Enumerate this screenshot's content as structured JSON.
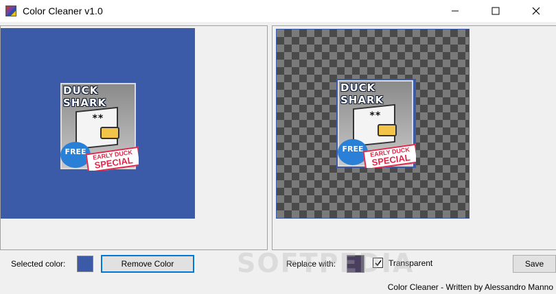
{
  "window": {
    "title": "Color Cleaner v1.0"
  },
  "artwork": {
    "title_line1": "DUCK",
    "title_line2": "SHARK",
    "badge": "FREE",
    "banner_line1": "EARLY DUCK",
    "banner_line2": "SPECIAL",
    "eyes": "**"
  },
  "left_panel": {
    "selected_color_label": "Selected color:",
    "selected_color": "#3b5ba8",
    "remove_color_label": "Remove Color"
  },
  "right_panel": {
    "replace_with_label": "Replace with:",
    "replace_color": "#4a3f5e",
    "transparent_label": "Transparent",
    "transparent_checked": true,
    "save_label": "Save"
  },
  "watermark": "SOFTPEDIA",
  "status": {
    "text": "Color Cleaner - Written by Alessandro Manno"
  }
}
